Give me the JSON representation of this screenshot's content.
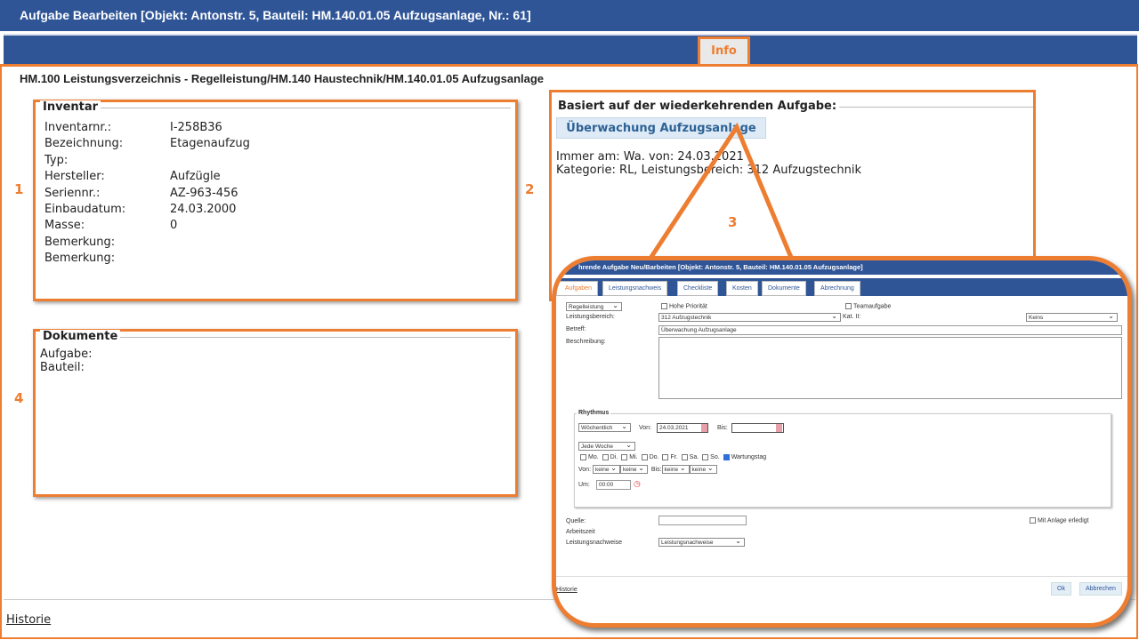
{
  "window": {
    "title": "Aufgabe Bearbeiten [Objekt: Antonstr. 5, Bauteil: HM.140.01.05 Aufzugsanlage, Nr.: 61]",
    "tab_info": "Info"
  },
  "breadcrumb": "HM.100 Leistungsverzeichnis - Regelleistung/HM.140 Haustechnik/HM.140.01.05 Aufzugsanlage",
  "inventar": {
    "legend": "Inventar",
    "rows": [
      {
        "label": "Inventarnr.:",
        "value": "I-258B36"
      },
      {
        "label": "Bezeichnung:",
        "value": "Etagenaufzug"
      },
      {
        "label": "Typ:",
        "value": ""
      },
      {
        "label": "Hersteller:",
        "value": "Aufzügle"
      },
      {
        "label": "Seriennr.:",
        "value": "AZ-963-456"
      },
      {
        "label": "Einbaudatum:",
        "value": "24.03.2000"
      },
      {
        "label": "Masse:",
        "value": "0"
      },
      {
        "label": "Bemerkung:",
        "value": ""
      },
      {
        "label": "Bemerkung:",
        "value": ""
      }
    ]
  },
  "dokumente": {
    "legend": "Dokumente",
    "aufgabe": "Aufgabe:",
    "bauteil": "Bauteil:"
  },
  "basiert": {
    "legend": "Basiert auf der wiederkehrenden Aufgabe:",
    "link": "Überwachung Aufzugsanlage",
    "line1": "Immer am: Wa. von: 24.03.2021",
    "line2": "Kategorie: RL, Leistungsbereich: 312 Aufzugstechnik"
  },
  "markers": [
    "1",
    "2",
    "3",
    "4"
  ],
  "footer": {
    "historie": "Historie"
  },
  "inset": {
    "title": "hrende Aufgabe Neu/Barbeiten [Objekt: Antonstr. 5, Bauteil: HM.140.01.05 Aufzugsanlage]",
    "tabs": [
      "Aufgaben",
      "Leistungsnachweis",
      "Checkliste",
      "Kosten",
      "Dokumente",
      "Abrechnung"
    ],
    "kategorie": "Regelleistung",
    "hohe_prioritaet": "Hohe Priorität",
    "teamaufgabe": "Teamaufgabe",
    "leistungsbereich_label": "Leistungsbereich:",
    "leistungsbereich": "312 Aufzugstechnik",
    "kat2_label": "Kat. II:",
    "kat2": "Keins",
    "betreff_label": "Betreff:",
    "betreff": "Überwachung Aufzugsanlage",
    "beschreibung_label": "Beschreibung:",
    "rhythmus": {
      "legend": "Rhythmus",
      "interval": "Wöchentlich",
      "von_label": "Von:",
      "von": "24.03.2021",
      "bis_label": "Bis:",
      "bis": "",
      "frequency": "Jede Woche",
      "days": [
        "Mo.",
        "Di.",
        "Mi.",
        "Do.",
        "Fr.",
        "Sa.",
        "So."
      ],
      "wartungstag": "Wartungstag",
      "von2_label": "Von:",
      "bis2_label": "Bis:",
      "keine": "keine",
      "um_label": "Um:",
      "um": "00:00"
    },
    "quelle_label": "Quelle:",
    "arbeitszeit_label": "Arbeitszeit",
    "leistungsnachweise_label": "Leistungsnachweise",
    "leistungsnachweise": "Leistungsnachweise",
    "mit_anlage": "Mit Anlage erledigt",
    "historie": "Historie",
    "ok": "Ok",
    "abbrechen": "Abbrechen"
  },
  "colors": {
    "header": "#2f5597",
    "accent": "#ed7d31"
  }
}
